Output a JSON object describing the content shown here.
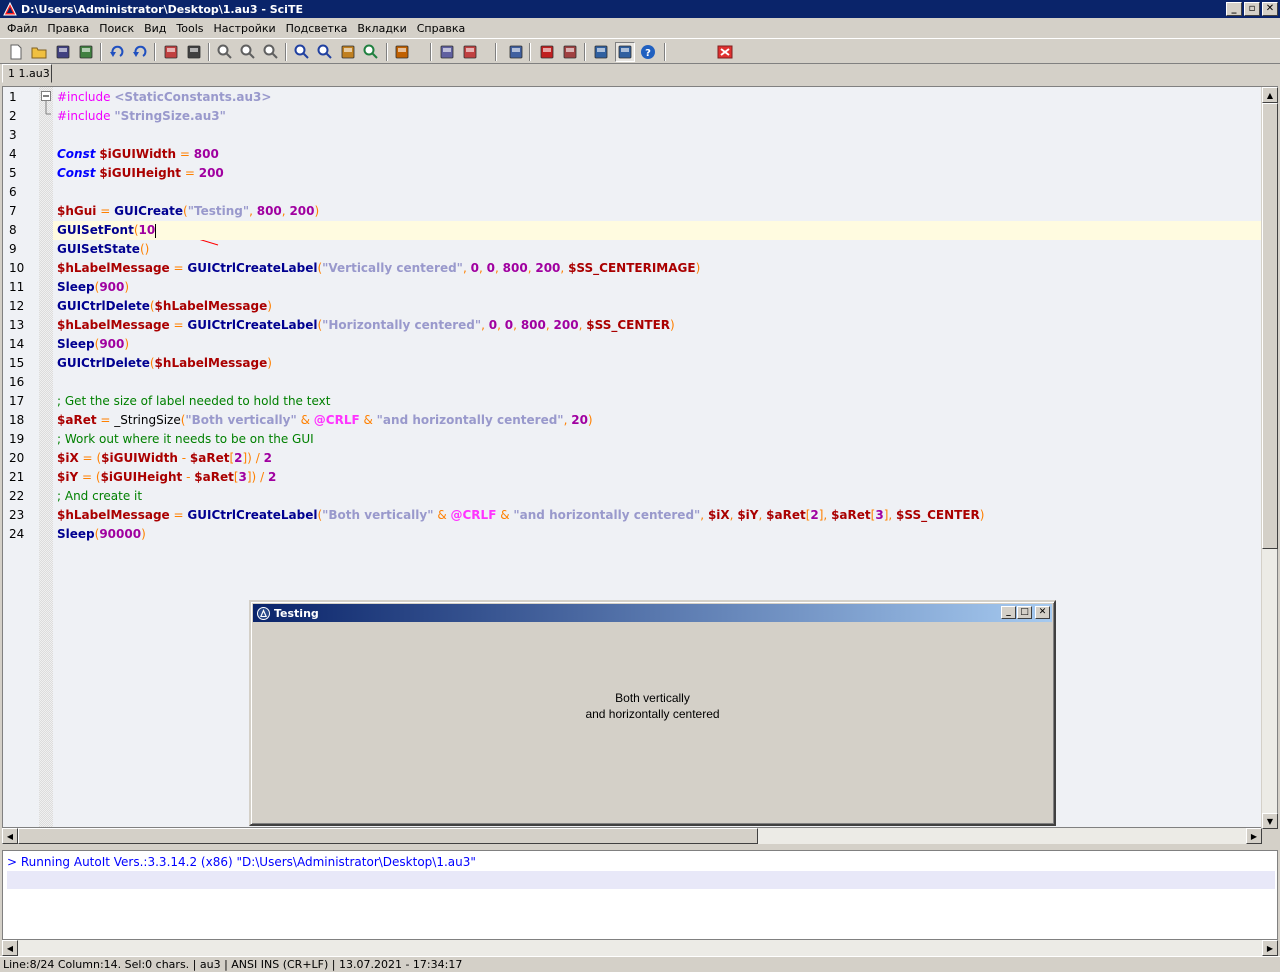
{
  "window": {
    "title": "D:\\Users\\Administrator\\Desktop\\1.au3 - SciTE",
    "caption_buttons": [
      "minimize",
      "restore",
      "close"
    ]
  },
  "menu": [
    "Файл",
    "Правка",
    "Поиск",
    "Вид",
    "Tools",
    "Настройки",
    "Подсветка",
    "Вкладки",
    "Справка"
  ],
  "toolbar": {
    "icons": [
      "new-file-icon",
      "open-folder-icon",
      "save-icon",
      "save-all-icon",
      "undo-icon",
      "redo-icon",
      "cut-icon",
      "print-icon",
      "zoom-in-icon",
      "zoom-out-icon",
      "zoom-reset-icon",
      "find-icon",
      "find-next-icon",
      "replace-icon",
      "find-in-files-icon",
      "bug-icon",
      "compile-icon",
      "build-icon",
      "tidy-icon",
      "bookmark-icon",
      "bookmark-next-icon",
      "split-view-icon",
      "output-toggle-icon",
      "help-icon",
      "stop-icon"
    ]
  },
  "tabs": [
    {
      "label": "1 1.au3",
      "active": true
    }
  ],
  "editor": {
    "current_line": 8,
    "lines": [
      [
        [
          "pp",
          "#include "
        ],
        [
          "str",
          "<StaticConstants.au3>"
        ]
      ],
      [
        [
          "pp",
          "#include "
        ],
        [
          "str",
          "\"StringSize.au3\""
        ]
      ],
      [],
      [
        [
          "kw",
          "Const"
        ],
        [
          "plain",
          " "
        ],
        [
          "var",
          "$iGUIWidth"
        ],
        [
          "plain",
          " "
        ],
        [
          "op",
          "="
        ],
        [
          "plain",
          " "
        ],
        [
          "num",
          "800"
        ]
      ],
      [
        [
          "kw",
          "Const"
        ],
        [
          "plain",
          " "
        ],
        [
          "var",
          "$iGUIHeight"
        ],
        [
          "plain",
          " "
        ],
        [
          "op",
          "="
        ],
        [
          "plain",
          " "
        ],
        [
          "num",
          "200"
        ]
      ],
      [],
      [
        [
          "var",
          "$hGui"
        ],
        [
          "plain",
          " "
        ],
        [
          "op",
          "="
        ],
        [
          "plain",
          " "
        ],
        [
          "fn",
          "GUICreate"
        ],
        [
          "brk",
          "("
        ],
        [
          "str",
          "\"Testing\""
        ],
        [
          "brk",
          ","
        ],
        [
          "plain",
          " "
        ],
        [
          "num",
          "800"
        ],
        [
          "brk",
          ","
        ],
        [
          "plain",
          " "
        ],
        [
          "num",
          "200"
        ],
        [
          "brk",
          ")"
        ]
      ],
      [
        [
          "fn",
          "GUISetFont"
        ],
        [
          "brk",
          "("
        ],
        [
          "num",
          "10"
        ]
      ],
      [
        [
          "fn",
          "GUISetState"
        ],
        [
          "brk",
          "()"
        ]
      ],
      [
        [
          "var",
          "$hLabelMessage"
        ],
        [
          "plain",
          " "
        ],
        [
          "op",
          "="
        ],
        [
          "plain",
          " "
        ],
        [
          "fn",
          "GUICtrlCreateLabel"
        ],
        [
          "brk",
          "("
        ],
        [
          "str",
          "\"Vertically centered\""
        ],
        [
          "brk",
          ","
        ],
        [
          "plain",
          " "
        ],
        [
          "num",
          "0"
        ],
        [
          "brk",
          ","
        ],
        [
          "plain",
          " "
        ],
        [
          "num",
          "0"
        ],
        [
          "brk",
          ","
        ],
        [
          "plain",
          " "
        ],
        [
          "num",
          "800"
        ],
        [
          "brk",
          ","
        ],
        [
          "plain",
          " "
        ],
        [
          "num",
          "200"
        ],
        [
          "brk",
          ","
        ],
        [
          "plain",
          " "
        ],
        [
          "var",
          "$SS_CENTERIMAGE"
        ],
        [
          "brk",
          ")"
        ]
      ],
      [
        [
          "fn",
          "Sleep"
        ],
        [
          "brk",
          "("
        ],
        [
          "num",
          "900"
        ],
        [
          "brk",
          ")"
        ]
      ],
      [
        [
          "fn",
          "GUICtrlDelete"
        ],
        [
          "brk",
          "("
        ],
        [
          "var",
          "$hLabelMessage"
        ],
        [
          "brk",
          ")"
        ]
      ],
      [
        [
          "var",
          "$hLabelMessage"
        ],
        [
          "plain",
          " "
        ],
        [
          "op",
          "="
        ],
        [
          "plain",
          " "
        ],
        [
          "fn",
          "GUICtrlCreateLabel"
        ],
        [
          "brk",
          "("
        ],
        [
          "str",
          "\"Horizontally centered\""
        ],
        [
          "brk",
          ","
        ],
        [
          "plain",
          " "
        ],
        [
          "num",
          "0"
        ],
        [
          "brk",
          ","
        ],
        [
          "plain",
          " "
        ],
        [
          "num",
          "0"
        ],
        [
          "brk",
          ","
        ],
        [
          "plain",
          " "
        ],
        [
          "num",
          "800"
        ],
        [
          "brk",
          ","
        ],
        [
          "plain",
          " "
        ],
        [
          "num",
          "200"
        ],
        [
          "brk",
          ","
        ],
        [
          "plain",
          " "
        ],
        [
          "var",
          "$SS_CENTER"
        ],
        [
          "brk",
          ")"
        ]
      ],
      [
        [
          "fn",
          "Sleep"
        ],
        [
          "brk",
          "("
        ],
        [
          "num",
          "900"
        ],
        [
          "brk",
          ")"
        ]
      ],
      [
        [
          "fn",
          "GUICtrlDelete"
        ],
        [
          "brk",
          "("
        ],
        [
          "var",
          "$hLabelMessage"
        ],
        [
          "brk",
          ")"
        ]
      ],
      [],
      [
        [
          "cmt",
          "; Get the size of label needed to hold the text"
        ]
      ],
      [
        [
          "var",
          "$aRet"
        ],
        [
          "plain",
          " "
        ],
        [
          "op",
          "="
        ],
        [
          "plain",
          " _StringSize"
        ],
        [
          "brk",
          "("
        ],
        [
          "str",
          "\"Both vertically\""
        ],
        [
          "plain",
          " "
        ],
        [
          "op",
          "&"
        ],
        [
          "plain",
          " "
        ],
        [
          "mac",
          "@CRLF"
        ],
        [
          "plain",
          " "
        ],
        [
          "op",
          "&"
        ],
        [
          "plain",
          " "
        ],
        [
          "str",
          "\"and horizontally centered\""
        ],
        [
          "brk",
          ","
        ],
        [
          "plain",
          " "
        ],
        [
          "num",
          "20"
        ],
        [
          "brk",
          ")"
        ]
      ],
      [
        [
          "cmt",
          "; Work out where it needs to be on the GUI"
        ]
      ],
      [
        [
          "var",
          "$iX"
        ],
        [
          "plain",
          " "
        ],
        [
          "op",
          "="
        ],
        [
          "plain",
          " "
        ],
        [
          "brk",
          "("
        ],
        [
          "var",
          "$iGUIWidth"
        ],
        [
          "plain",
          " "
        ],
        [
          "op",
          "-"
        ],
        [
          "plain",
          " "
        ],
        [
          "var",
          "$aRet"
        ],
        [
          "brk",
          "["
        ],
        [
          "num",
          "2"
        ],
        [
          "brk",
          "])"
        ],
        [
          "plain",
          " "
        ],
        [
          "op",
          "/"
        ],
        [
          "plain",
          " "
        ],
        [
          "num",
          "2"
        ]
      ],
      [
        [
          "var",
          "$iY"
        ],
        [
          "plain",
          " "
        ],
        [
          "op",
          "="
        ],
        [
          "plain",
          " "
        ],
        [
          "brk",
          "("
        ],
        [
          "var",
          "$iGUIHeight"
        ],
        [
          "plain",
          " "
        ],
        [
          "op",
          "-"
        ],
        [
          "plain",
          " "
        ],
        [
          "var",
          "$aRet"
        ],
        [
          "brk",
          "["
        ],
        [
          "num",
          "3"
        ],
        [
          "brk",
          "])"
        ],
        [
          "plain",
          " "
        ],
        [
          "op",
          "/"
        ],
        [
          "plain",
          " "
        ],
        [
          "num",
          "2"
        ]
      ],
      [
        [
          "cmt",
          "; And create it"
        ]
      ],
      [
        [
          "var",
          "$hLabelMessage"
        ],
        [
          "plain",
          " "
        ],
        [
          "op",
          "="
        ],
        [
          "plain",
          " "
        ],
        [
          "fn",
          "GUICtrlCreateLabel"
        ],
        [
          "brk",
          "("
        ],
        [
          "str",
          "\"Both vertically\""
        ],
        [
          "plain",
          " "
        ],
        [
          "op",
          "&"
        ],
        [
          "plain",
          " "
        ],
        [
          "mac",
          "@CRLF"
        ],
        [
          "plain",
          " "
        ],
        [
          "op",
          "&"
        ],
        [
          "plain",
          " "
        ],
        [
          "str",
          "\"and horizontally centered\""
        ],
        [
          "brk",
          ","
        ],
        [
          "plain",
          " "
        ],
        [
          "var",
          "$iX"
        ],
        [
          "brk",
          ","
        ],
        [
          "plain",
          " "
        ],
        [
          "var",
          "$iY"
        ],
        [
          "brk",
          ","
        ],
        [
          "plain",
          " "
        ],
        [
          "var",
          "$aRet"
        ],
        [
          "brk",
          "["
        ],
        [
          "num",
          "2"
        ],
        [
          "brk",
          "],"
        ],
        [
          "plain",
          " "
        ],
        [
          "var",
          "$aRet"
        ],
        [
          "brk",
          "["
        ],
        [
          "num",
          "3"
        ],
        [
          "brk",
          "],"
        ],
        [
          "plain",
          " "
        ],
        [
          "var",
          "$SS_CENTER"
        ],
        [
          "brk",
          ")"
        ]
      ],
      [
        [
          "fn",
          "Sleep"
        ],
        [
          "brk",
          "("
        ],
        [
          "num",
          "90000"
        ],
        [
          "brk",
          ")"
        ]
      ]
    ]
  },
  "output": {
    "lines": [
      "> Running AutoIt Vers.:3.3.14.2 (x86) \"D:\\Users\\Administrator\\Desktop\\1.au3\""
    ]
  },
  "statusbar": {
    "text": "Line:8/24 Column:14. Sel:0 chars. | au3 | ANSI INS (CR+LF) | 13.07.2021 - 17:34:17"
  },
  "dialog": {
    "title": "Testing",
    "label_line1": "Both vertically",
    "label_line2": "and horizontally centered"
  },
  "colors": {
    "titlebar": "#0a246a",
    "annotation": "#ff0000",
    "editor_bg": "#eff1f5"
  }
}
